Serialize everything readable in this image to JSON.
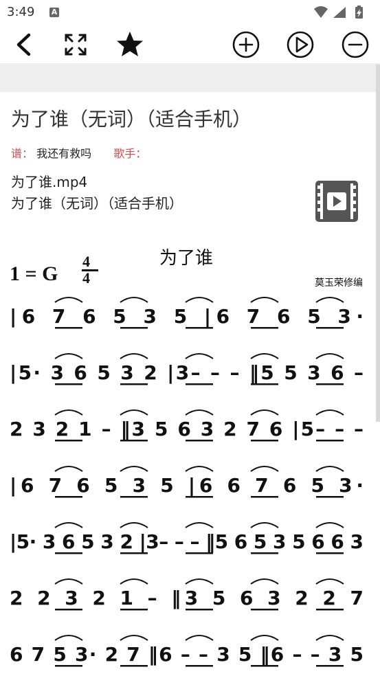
{
  "status_bar": {
    "time": "3:49",
    "notification_icon": "text-a-icon",
    "system_icons": [
      "wifi-icon",
      "signal-icon",
      "battery-charging-icon"
    ]
  },
  "toolbar": {
    "back": "chevron-left-icon",
    "fullscreen": "expand-icon",
    "favorite": "star-icon",
    "zoom_in": "plus-circle-icon",
    "play": "play-circle-icon",
    "zoom_out": "minus-circle-icon"
  },
  "song": {
    "title": "为了谁（无词）（适合手机）",
    "score_label": "谱：",
    "score_value": "我还有救吗",
    "singer_label": "歌手：",
    "singer_value": "",
    "file_name": "为了谁.mp4",
    "file_title": "为了谁（无词）（适合手机）"
  },
  "sheet": {
    "key": "1 = G",
    "time_top": "4",
    "time_bottom": "4",
    "song_title": "为了谁",
    "editor": "莫玉荣修编",
    "lines": [
      "|6  7 6  5  3 5 |6  7 6  5  3·",
      "|5· 3 6 5 3 2 |3– – – ‖5  5 3 6 –",
      "2  3 2 1 – ‖3 5 6 3 2  7 6 |5– – –",
      "|6  7 6  5  3 5 |6 6 7 6  5  3·",
      "|5· 3 6 5 3 2 |3– – – ‖5 6 5 3 5 6  6 3",
      "2 2  3 2  1 –  ‖3  5  6  3  2  2 7",
      "6 7 5 3· 2 7 ‖6 – – 3 5 ‖6 – – 3 5"
    ]
  },
  "colors": {
    "label_red": "#d0504f",
    "band_gray": "#eeeeee",
    "icon_dark": "#111111"
  }
}
